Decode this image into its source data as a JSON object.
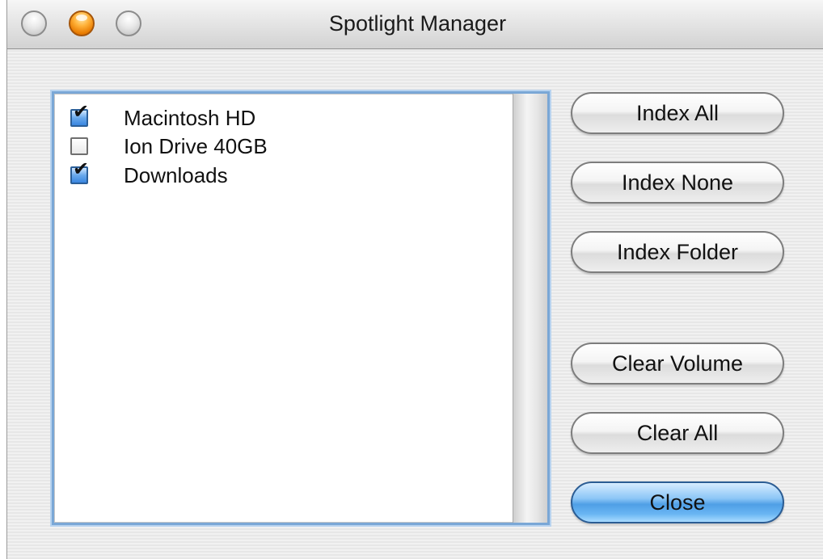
{
  "window": {
    "title": "Spotlight Manager"
  },
  "volumes": [
    {
      "name": "Macintosh HD",
      "checked": true
    },
    {
      "name": "Ion Drive 40GB",
      "checked": false
    },
    {
      "name": "Downloads",
      "checked": true
    }
  ],
  "buttons": {
    "index_all": "Index All",
    "index_none": "Index None",
    "index_folder": "Index Folder",
    "clear_volume": "Clear Volume",
    "clear_all": "Clear All",
    "close": "Close"
  },
  "colors": {
    "default_button": "#4f9fe6",
    "focus_ring": "#7aa7d6",
    "close_light": "#ffb23a"
  },
  "icons": {
    "checkmark": "✔"
  }
}
